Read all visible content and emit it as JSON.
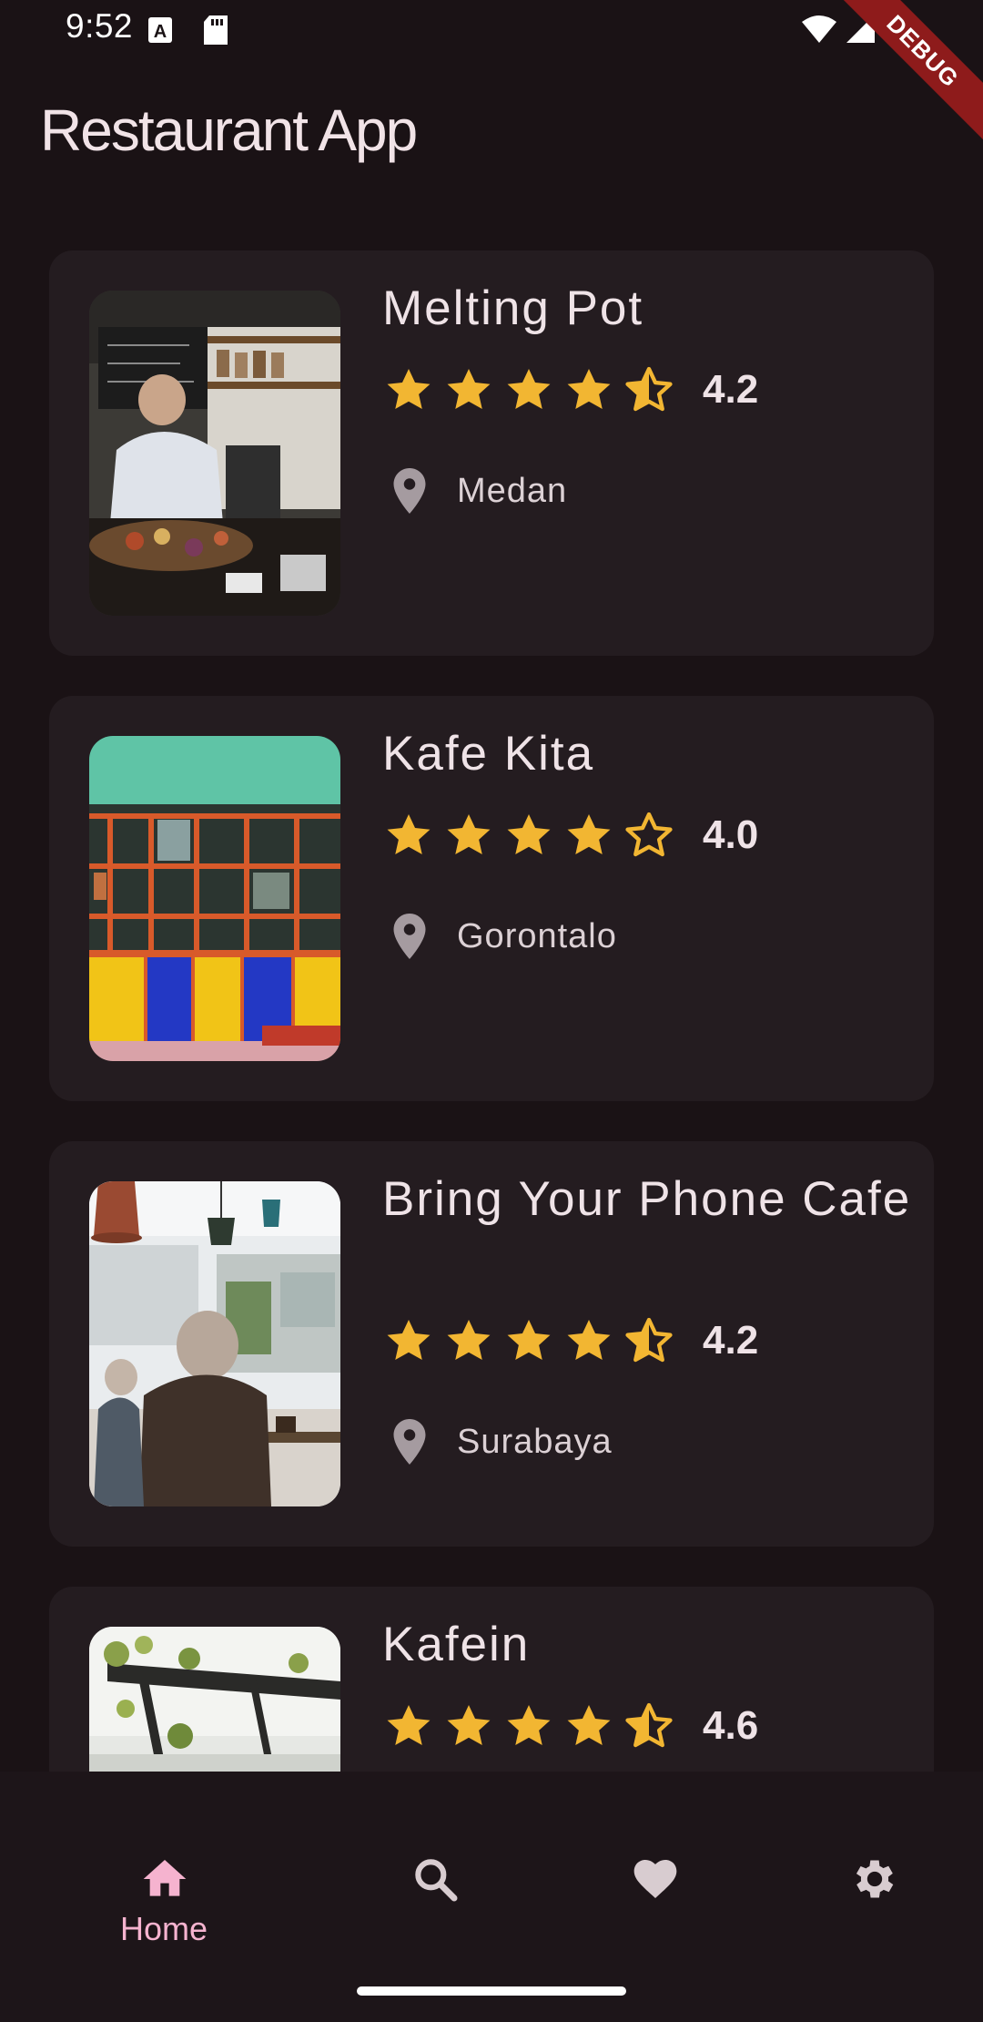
{
  "status_bar": {
    "time": "9:52",
    "debug_label": "DEBUG"
  },
  "app_bar": {
    "title": "Restaurant App"
  },
  "colors": {
    "background": "#1a1215",
    "card": "#241c20",
    "star": "#f2b632",
    "nav_active": "#f5b3cf",
    "nav_inactive": "#d8ccd0"
  },
  "restaurants": [
    {
      "name": "Melting Pot",
      "rating": "4.2",
      "stars": [
        "full",
        "full",
        "full",
        "full",
        "half"
      ],
      "city": "Medan"
    },
    {
      "name": "Kafe Kita",
      "rating": "4.0",
      "stars": [
        "full",
        "full",
        "full",
        "full",
        "empty"
      ],
      "city": "Gorontalo"
    },
    {
      "name": "Bring Your Phone Cafe",
      "rating": "4.2",
      "stars": [
        "full",
        "full",
        "full",
        "full",
        "half"
      ],
      "city": "Surabaya"
    },
    {
      "name": "Kafein",
      "rating": "4.6",
      "stars": [
        "full",
        "full",
        "full",
        "full",
        "half"
      ],
      "city": ""
    }
  ],
  "bottom_nav": {
    "items": [
      {
        "icon": "home-icon",
        "label": "Home",
        "active": true
      },
      {
        "icon": "search-icon",
        "label": "",
        "active": false
      },
      {
        "icon": "heart-icon",
        "label": "",
        "active": false
      },
      {
        "icon": "settings-icon",
        "label": "",
        "active": false
      }
    ]
  }
}
